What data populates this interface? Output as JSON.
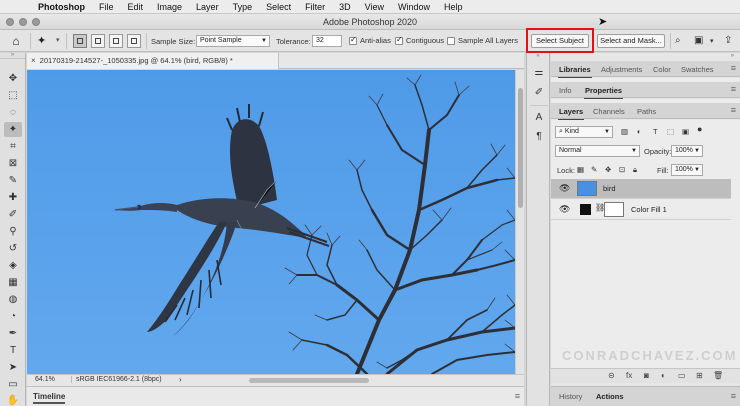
{
  "menubar": {
    "apple": "",
    "app": "Photoshop",
    "items": [
      "File",
      "Edit",
      "Image",
      "Layer",
      "Type",
      "Select",
      "Filter",
      "3D",
      "View",
      "Window",
      "Help"
    ]
  },
  "window": {
    "title": "Adobe Photoshop 2020"
  },
  "options": {
    "sample_size_label": "Sample Size:",
    "sample_size_value": "Point Sample",
    "tolerance_label": "Tolerance:",
    "tolerance_value": "32",
    "anti_alias": "Anti-alias",
    "contiguous": "Contiguous",
    "sample_all_layers": "Sample All Layers",
    "select_subject": "Select Subject",
    "select_and_mask": "Select and Mask..."
  },
  "document": {
    "tab_title": "20170319-214527-_1050335.jpg @ 64.1% (bird, RGB/8) *",
    "zoom": "64.1%",
    "profile": "sRGB IEC61966-2.1 (8bpc)"
  },
  "timeline": {
    "label": "Timeline"
  },
  "panels": {
    "top_tabs": [
      "Libraries",
      "Adjustments",
      "Color",
      "Swatches"
    ],
    "mid_tabs": [
      "Info",
      "Properties"
    ],
    "layer_tabs": [
      "Layers",
      "Channels",
      "Paths"
    ],
    "kind_filter": "Kind",
    "blend_mode": "Normal",
    "opacity_label": "Opacity:",
    "opacity_value": "100%",
    "lock_label": "Lock:",
    "fill_label": "Fill:",
    "fill_value": "100%",
    "layers": [
      {
        "name": "bird",
        "selected": true
      },
      {
        "name": "Color Fill 1",
        "selected": false
      }
    ],
    "bottom_tabs": [
      "History",
      "Actions"
    ]
  },
  "watermark": "CONRADCHAVEZ.COM",
  "colors": {
    "sky": "#56a0ea",
    "highlight": "#e21212"
  }
}
